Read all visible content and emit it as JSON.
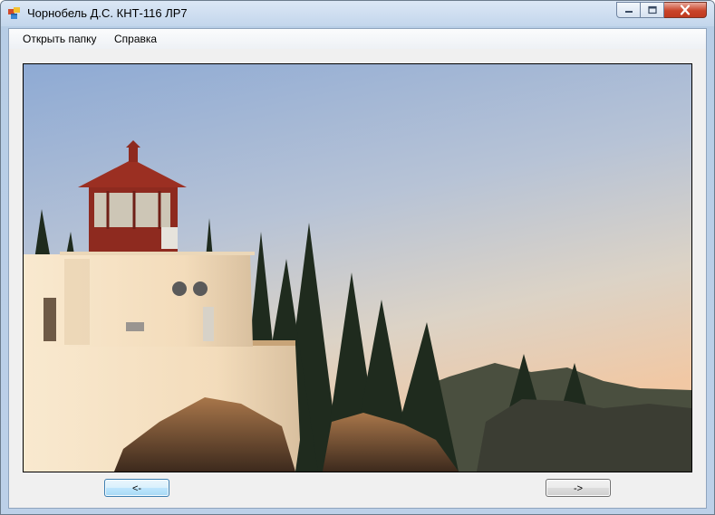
{
  "window": {
    "title": "Чорнобель Д.С. КНТ-116 ЛР7",
    "icon": "application-icon",
    "controls": [
      "minimize-icon",
      "maximize-icon",
      "close-icon"
    ]
  },
  "menu": {
    "items": [
      {
        "label": "Открыть папку"
      },
      {
        "label": "Справка"
      }
    ]
  },
  "picture": {
    "subject": "lighthouse-photo"
  },
  "navigation": {
    "prev_label": "<-",
    "next_label": "->"
  },
  "colors": {
    "close_button": "#c9442a",
    "focused_button_border": "#3c7fb1",
    "lighthouse_roof": "#8e2a1f"
  }
}
